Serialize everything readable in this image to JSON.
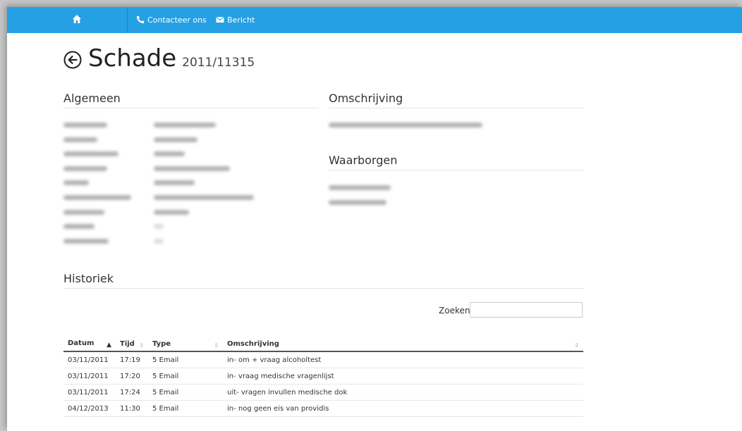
{
  "nav": {
    "contact_label": "Contacteer ons",
    "message_label": "Bericht"
  },
  "header": {
    "title": "Schade",
    "subtitle": "2011/11315"
  },
  "sections": {
    "general": "Algemeen",
    "description": "Omschrijving",
    "guarantees": "Waarborgen",
    "history": "Historiek"
  },
  "search": {
    "label": "Zoeken",
    "value": ""
  },
  "table": {
    "columns": [
      "Datum",
      "Tijd",
      "Type",
      "Omschrijving"
    ],
    "rows": [
      {
        "date": "03/11/2011",
        "time": "17:19",
        "type": "5 Email",
        "desc": "in- om + vraag alcoholtest"
      },
      {
        "date": "03/11/2011",
        "time": "17:20",
        "type": "5 Email",
        "desc": "in- vraag medische vragenlijst"
      },
      {
        "date": "03/11/2011",
        "time": "17:24",
        "type": "5 Email",
        "desc": "uit- vragen invullen medische dok"
      },
      {
        "date": "04/12/2013",
        "time": "11:30",
        "type": "5 Email",
        "desc": "in- nog geen eis van providis"
      }
    ]
  },
  "colors": {
    "topbar": "#25a0e4",
    "text": "#333333"
  }
}
